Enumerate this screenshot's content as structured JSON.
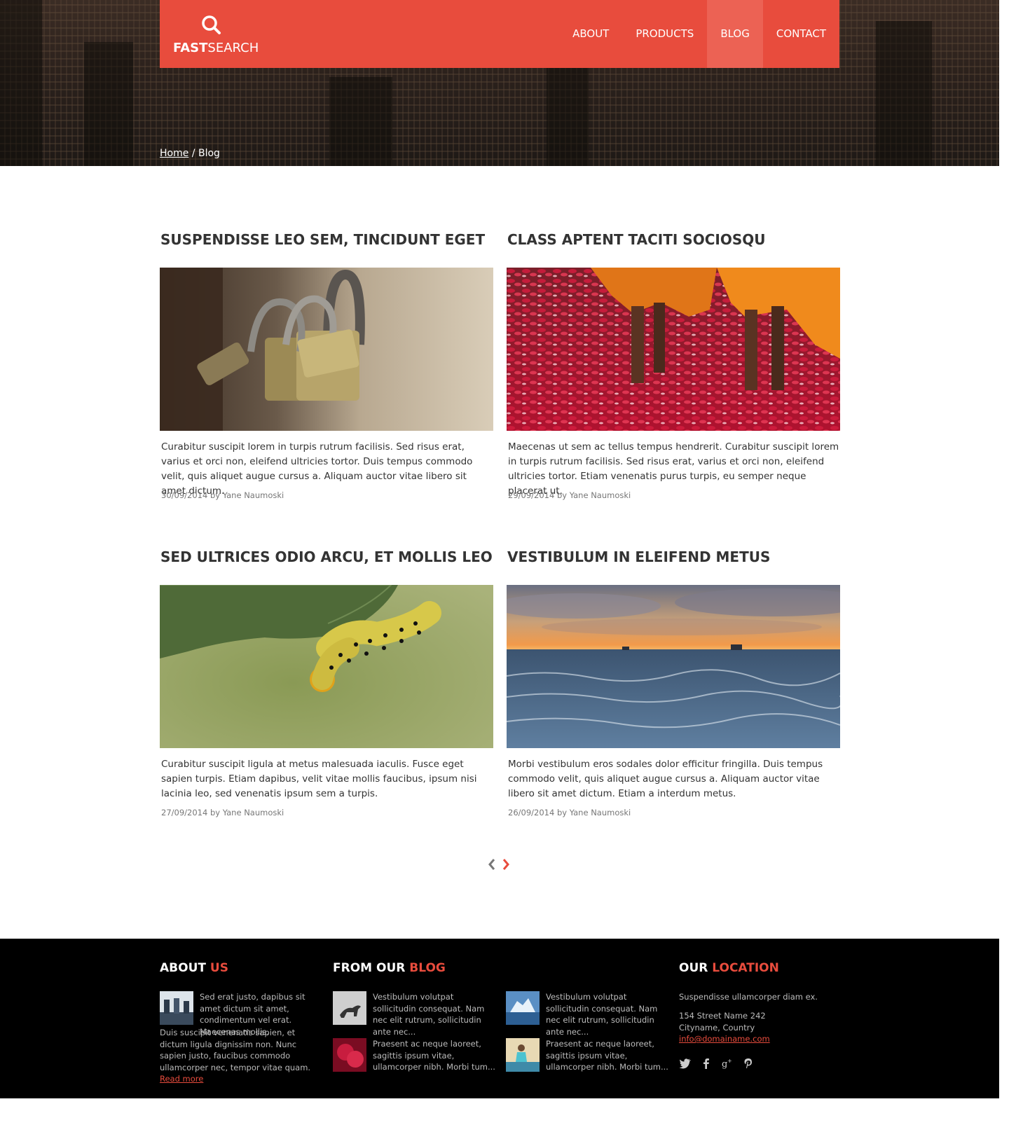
{
  "header": {
    "logo_bold": "FAST",
    "logo_light": "SEARCH",
    "nav": [
      {
        "label": "ABOUT",
        "active": false
      },
      {
        "label": "PRODUCTS",
        "active": false
      },
      {
        "label": "BLOG",
        "active": true
      },
      {
        "label": "CONTACT",
        "active": false
      }
    ]
  },
  "breadcrumb": {
    "home": "Home",
    "separator": " / ",
    "current": "Blog"
  },
  "posts": [
    {
      "title": "SUSPENDISSE LEO SEM, TINCIDUNT EGET",
      "image": "padlocks-photo",
      "excerpt": "Curabitur suscipit lorem in turpis rutrum facilisis. Sed risus erat, varius et orci non, eleifend ultricies tortor. Duis tempus commodo velit, quis aliquet augue cursus a. Aliquam auctor vitae libero sit amet dictum.",
      "meta": "30/09/2014 by Yane Naumoski"
    },
    {
      "title": "CLASS APTENT TACITI SOCIOSQU",
      "image": "rose-petals-photo",
      "excerpt": "Maecenas ut sem ac tellus tempus hendrerit. Curabitur suscipit lorem in turpis rutrum facilisis. Sed risus erat, varius et orci non, eleifend ultricies tortor. Etiam venenatis purus turpis, eu semper neque placerat ut.",
      "meta": "29/09/2014 by Yane Naumoski"
    },
    {
      "title": "SED ULTRICES ODIO ARCU, ET MOLLIS LEO",
      "image": "caterpillar-photo",
      "excerpt": "Curabitur suscipit ligula at metus malesuada iaculis. Fusce eget sapien turpis. Etiam dapibus, velit vitae mollis faucibus, ipsum nisi lacinia leo, sed venenatis ipsum sem a turpis.",
      "meta": "27/09/2014 by Yane Naumoski"
    },
    {
      "title": "VESTIBULUM IN ELEIFEND METUS",
      "image": "sea-sunset-photo",
      "excerpt": "Morbi vestibulum eros sodales dolor efficitur fringilla. Duis tempus commodo velit, quis aliquet augue cursus a. Aliquam auctor vitae libero sit amet dictum. Etiam a interdum metus.",
      "meta": "26/09/2014 by Yane Naumoski"
    }
  ],
  "pager": {
    "prev_icon": "chevron-left-icon",
    "next_icon": "chevron-right-icon"
  },
  "footer": {
    "about": {
      "head_white": "ABOUT ",
      "head_accent": "US",
      "text": "Sed erat justo, dapibus sit amet dictum sit amet, condimentum vel erat. Maecenas mollis.",
      "text2": "Duis suscipit venenatis sapien, et dictum ligula dignissim non. Nunc sapien justo, faucibus commodo ullamcorper nec, tempor vitae quam.",
      "read_more": "Read more"
    },
    "blog": {
      "head_white": "FROM OUR ",
      "head_accent": "BLOG",
      "items": [
        {
          "text": "Vestibulum volutpat sollicitudin consequat. Nam nec elit rutrum, sollicitudin ante nec..."
        },
        {
          "text": "Vestibulum volutpat sollicitudin consequat. Nam nec elit rutrum, sollicitudin ante nec..."
        },
        {
          "text": "Praesent ac neque laoreet, sagittis ipsum vitae, ullamcorper nibh. Morbi tum..."
        },
        {
          "text": "Praesent ac neque laoreet, sagittis ipsum vitae, ullamcorper nibh. Morbi tum..."
        }
      ]
    },
    "location": {
      "head_white": "OUR ",
      "head_accent": "LOCATION",
      "tagline": "Suspendisse ullamcorper diam ex.",
      "street": "154 Street Name 242",
      "city": "Cityname, Country",
      "email": "info@domainame.com",
      "social": [
        "twitter-icon",
        "facebook-icon",
        "google-plus-icon",
        "pinterest-icon"
      ]
    }
  },
  "colors": {
    "accent": "#e84c3d",
    "accent_active": "#ec6254",
    "footer_bg": "#000000"
  }
}
